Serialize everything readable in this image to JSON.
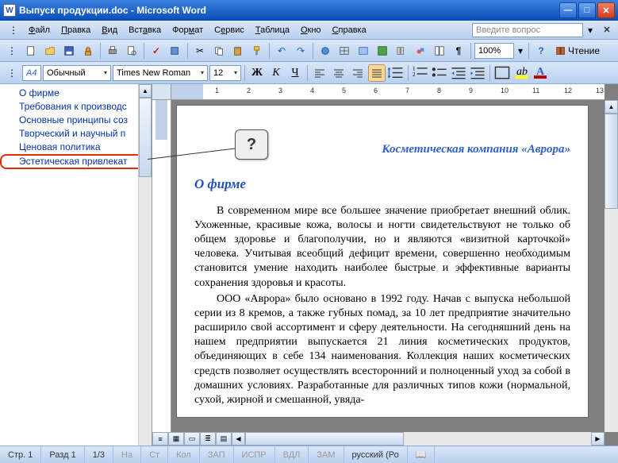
{
  "title": "Выпуск продукции.doc - Microsoft Word",
  "menus": [
    "Файл",
    "Правка",
    "Вид",
    "Вставка",
    "Формат",
    "Сервис",
    "Таблица",
    "Окно",
    "Справка"
  ],
  "help_placeholder": "Введите вопрос",
  "zoom": "100%",
  "read_mode": "Чтение",
  "fmt": {
    "style_prefix": "A4",
    "style": "Обычный",
    "font": "Times New Roman",
    "size": "12",
    "bold": "Ж",
    "italic": "К",
    "underline": "Ч"
  },
  "outline": [
    "О фирме",
    "Требования к производс",
    "Основные принципы соз",
    "Творческий и научный п",
    "Ценовая политика",
    "Эстетическая привлекат"
  ],
  "callout": "?",
  "ruler_ticks": [
    "1",
    "2",
    "3",
    "4",
    "5",
    "6",
    "7",
    "8",
    "9",
    "10",
    "11",
    "12",
    "13"
  ],
  "doc": {
    "company": "Косметическая компания «Аврора»",
    "heading": "О фирме",
    "p1": "В современном мире все большее значение приобретает внешний облик. Ухоженные, красивые кожа, волосы и ногти свидетельствуют не только об общем здоровье и благополучии, но и являются «визитной карточкой» человека. Учитывая всеобщий дефицит времени, совершенно необходимым становится умение находить наиболее быстрые и эффективные варианты сохранения здоровья и красоты.",
    "p2": "ООО «Аврора» было основано в 1992 году. Начав с выпуска небольшой серии из 8 кремов, а также губных помад, за 10 лет предприятие значительно расширило свой ассортимент и сферу деятельности. На сегодняшний день на нашем предприятии выпускается 21 линия косметических продуктов, объединяющих в себе 134 наименования. Коллекция наших косметических средств позволяет осуществлять всесторонний и полноценный уход за собой в домашних условиях. Разработанные для различных типов кожи (нормальной, сухой, жирной и смешанной, увяда-"
  },
  "status": {
    "page": "Стр. 1",
    "section": "Разд 1",
    "pages": "1/3",
    "at": "На",
    "ln": "Ст",
    "col": "Кол",
    "rec": "ЗАП",
    "trk": "ИСПР",
    "ext": "ВДЛ",
    "ovr": "ЗАМ",
    "lang": "русский (Ро"
  }
}
